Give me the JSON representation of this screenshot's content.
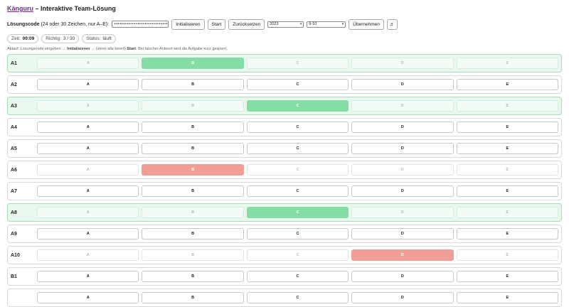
{
  "title": {
    "brand": "Känguru",
    "rest": " – Interaktive Team-Lösung"
  },
  "code": {
    "label": "Lösungscode",
    "hint": " (24 oder 30 Zeichen, nur A–E):",
    "value": "••••••••••••••••••••••••••••••"
  },
  "buttons": {
    "init": "Initialisieren",
    "start": "Start",
    "reset": "Zurücksetzen",
    "apply": "Übernehmen"
  },
  "selects": {
    "year": "2023",
    "grade": "9-10"
  },
  "status": {
    "time_label": "Zeit:",
    "time_value": "00:09",
    "correct_label": "Richtig:",
    "correct_value": "3 / 30",
    "status_label": "Status:",
    "status_value": "läuft"
  },
  "hint": {
    "p1": "Ablauf: Lösungscode eingeben → ",
    "b1": "Initialisieren",
    "p2": " → (wenn alle bereit) ",
    "b2": "Start",
    "p3": ". Bei falscher Antwort wird die Aufgabe kurz gesperrt."
  },
  "rows": [
    {
      "label": "A1",
      "state": "done",
      "opts": [
        "A",
        "B",
        "C",
        "D",
        "E"
      ],
      "marks": [
        "dim",
        "correct",
        "dim",
        "dim",
        "dim"
      ]
    },
    {
      "label": "A2",
      "state": "open",
      "opts": [
        "A",
        "B",
        "C",
        "D",
        "E"
      ],
      "marks": [
        "",
        "",
        "",
        "",
        ""
      ]
    },
    {
      "label": "A3",
      "state": "done",
      "opts": [
        "A",
        "B",
        "C",
        "D",
        "E"
      ],
      "marks": [
        "dim",
        "dim",
        "correct",
        "dim",
        "dim"
      ]
    },
    {
      "label": "A4",
      "state": "open",
      "opts": [
        "A",
        "B",
        "C",
        "D",
        "E"
      ],
      "marks": [
        "",
        "",
        "",
        "",
        ""
      ]
    },
    {
      "label": "A5",
      "state": "open",
      "opts": [
        "A",
        "B",
        "C",
        "D",
        "E"
      ],
      "marks": [
        "",
        "",
        "",
        "",
        ""
      ]
    },
    {
      "label": "A6",
      "state": "locked",
      "opts": [
        "A",
        "B",
        "C",
        "D",
        "E"
      ],
      "marks": [
        "dim",
        "wrong",
        "dim",
        "dim",
        "dim"
      ]
    },
    {
      "label": "A7",
      "state": "open",
      "opts": [
        "A",
        "B",
        "C",
        "D",
        "E"
      ],
      "marks": [
        "",
        "",
        "",
        "",
        ""
      ]
    },
    {
      "label": "A8",
      "state": "done",
      "opts": [
        "A",
        "B",
        "C",
        "D",
        "E"
      ],
      "marks": [
        "dim",
        "dim",
        "correct",
        "dim",
        "dim"
      ]
    },
    {
      "label": "A9",
      "state": "open",
      "opts": [
        "A",
        "B",
        "C",
        "D",
        "E"
      ],
      "marks": [
        "",
        "",
        "",
        "",
        ""
      ]
    },
    {
      "label": "A10",
      "state": "locked",
      "opts": [
        "A",
        "B",
        "C",
        "D",
        "E"
      ],
      "marks": [
        "dim",
        "dim",
        "dim",
        "wrong",
        "dim"
      ]
    },
    {
      "label": "B1",
      "state": "open",
      "opts": [
        "A",
        "B",
        "C",
        "D",
        "E"
      ],
      "marks": [
        "",
        "",
        "",
        "",
        ""
      ]
    },
    {
      "label": "",
      "state": "open",
      "opts": [
        "A",
        "B",
        "C",
        "D",
        "E"
      ],
      "marks": [
        "",
        "",
        "",
        "",
        ""
      ]
    }
  ],
  "colors": {
    "correct": "#83dda4",
    "wrong": "#f19f95",
    "done_row": "#e9f7ee",
    "brand": "#6b2d91"
  },
  "icons": {
    "music": "music-note-icon",
    "chevron": "chevron-down-icon"
  }
}
